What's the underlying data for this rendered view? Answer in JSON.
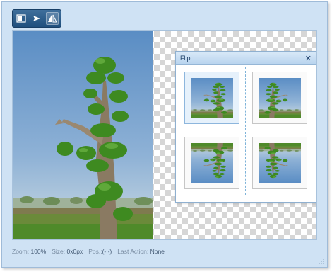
{
  "toolbar": {
    "tools": [
      {
        "icon": "crop-frame-icon"
      },
      {
        "icon": "rotate-arrow-icon"
      },
      {
        "icon": "flip-icon"
      }
    ]
  },
  "flip_panel": {
    "title": "Flip",
    "close_glyph": "✕",
    "options": [
      {
        "icon": "flip-none-thumbnail",
        "selected": true
      },
      {
        "icon": "flip-horizontal-thumbnail",
        "selected": false
      },
      {
        "icon": "flip-vertical-thumbnail",
        "selected": false
      },
      {
        "icon": "flip-both-thumbnail",
        "selected": false
      }
    ]
  },
  "status": {
    "zoom_label": "Zoom:",
    "zoom_value": "100%",
    "size_label": "Size:",
    "size_value": "0x0px",
    "pos_label": "Pos.:",
    "pos_value": "(-,-)",
    "action_label": "Last Action:",
    "action_value": "None"
  },
  "colors": {
    "window_bg": "#cfe2f4",
    "toolbar_bg": "#1f4f7d",
    "sky_top": "#5c8fc5",
    "sky_bottom": "#c9dce6",
    "foliage": "#3f8a22",
    "grass": "#5a8f2c"
  }
}
